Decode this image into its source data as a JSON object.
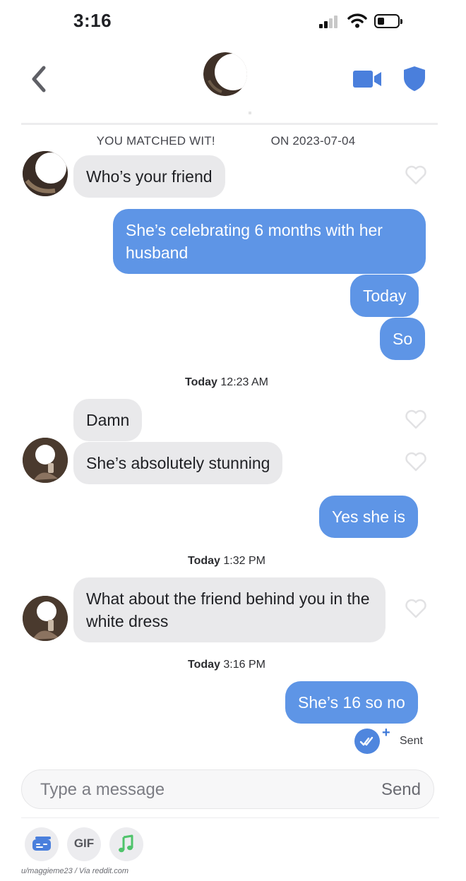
{
  "status_bar": {
    "time": "3:16"
  },
  "header": {
    "back_icon": "chevron-left-icon",
    "video_icon": "video-camera-icon",
    "shield_icon": "shield-icon",
    "accent_color": "#4a7fdc"
  },
  "match_banner": "YOU MATCHED WIT!                ON 2023-07-04",
  "messages": [
    {
      "from": "them",
      "text": "Who’s your friend"
    },
    {
      "from": "me",
      "text": "She’s celebrating 6 months with her husband"
    },
    {
      "from": "me",
      "text": "Today"
    },
    {
      "from": "me",
      "text": "So"
    },
    {
      "from": "them",
      "text": "Damn"
    },
    {
      "from": "them",
      "text": "She’s absolutely stunning"
    },
    {
      "from": "me",
      "text": "Yes she is"
    },
    {
      "from": "them",
      "text": "What about the friend behind you in the white dress"
    },
    {
      "from": "me",
      "text": "She’s 16 so no"
    }
  ],
  "timestamps": [
    {
      "day": "Today",
      "time": "12:23 AM"
    },
    {
      "day": "Today",
      "time": "1:32 PM"
    },
    {
      "day": "Today",
      "time": "3:16 PM"
    }
  ],
  "delivery": {
    "status": "Sent"
  },
  "composer": {
    "placeholder": "Type a message",
    "send_label": "Send"
  },
  "toolbar": {
    "gif_label": "GIF"
  },
  "credit": "u/maggieme23 / Via reddit.com",
  "colors": {
    "outgoing_bubble": "#5e95e6",
    "incoming_bubble": "#e9e9eb",
    "music_icon": "#4fc36b"
  }
}
